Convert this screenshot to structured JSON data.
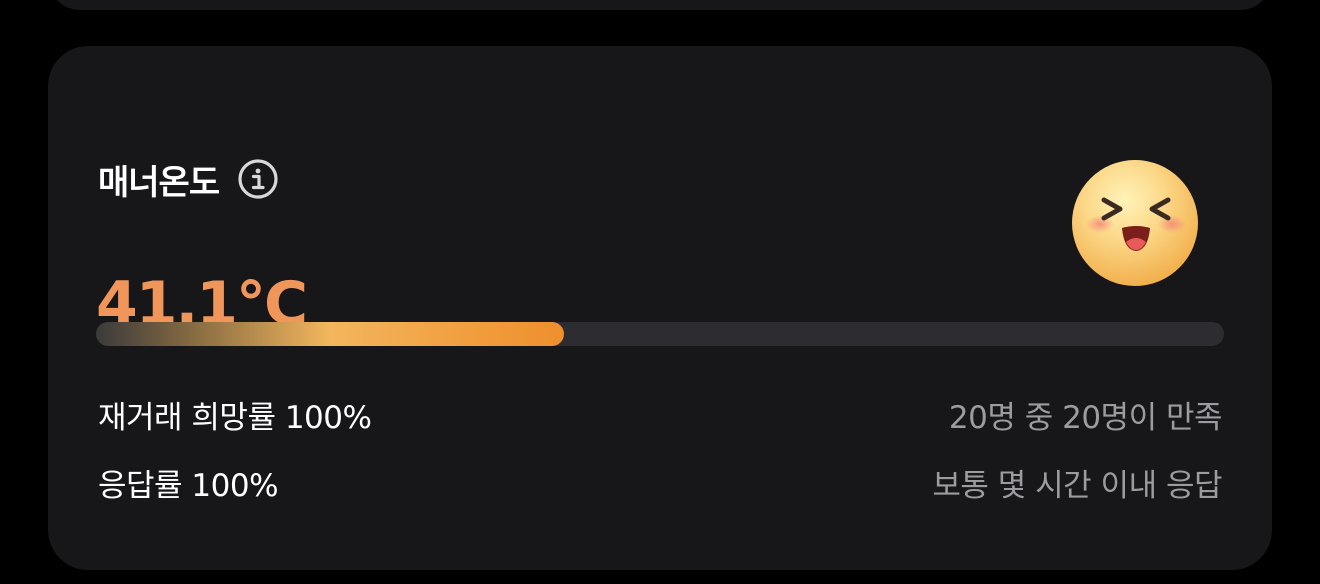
{
  "manner": {
    "title": "매너온도",
    "temperature": "41.1°C",
    "temperature_color": "#f0965a",
    "progress_percent": 41.5,
    "rematch": {
      "label": "재거래 희망률 100%",
      "detail": "20명 중 20명이 만족"
    },
    "response": {
      "label": "응답률 100%",
      "detail": "보통 몇 시간 이내 응답"
    }
  },
  "icons": {
    "info": "info-circle-icon",
    "face": "laughing-face-icon"
  },
  "colors": {
    "background": "#000000",
    "card": "#17171a",
    "bar_track": "#2c2c31",
    "accent": "#ee8f2e",
    "muted_text": "#9b9ba0"
  }
}
